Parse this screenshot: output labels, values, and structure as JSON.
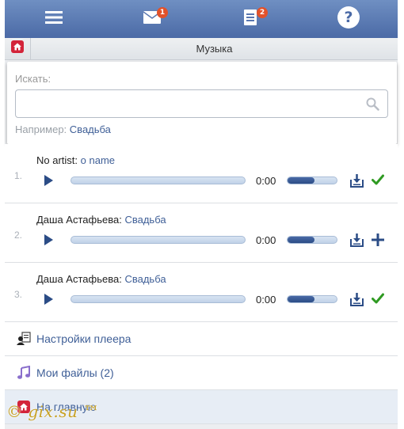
{
  "topbar": {
    "menu_icon": "hamburger-menu-icon",
    "messages_icon": "envelope-icon",
    "messages_badge": "1",
    "notifications_icon": "document-list-icon",
    "notifications_badge": "2",
    "help_icon": "help-question-icon"
  },
  "header": {
    "home_icon": "home-icon",
    "title": "Музыка"
  },
  "search": {
    "label": "Искать:",
    "value": "",
    "placeholder": "",
    "icon": "search-icon",
    "example_label": "Например:",
    "example_value": "Свадьба"
  },
  "tracks": [
    {
      "number": "1.",
      "artist": "No artist:",
      "song": "o name",
      "time": "0:00",
      "volume": 0.55,
      "action_icon": "check-icon"
    },
    {
      "number": "2.",
      "artist": "Даша Астафьева:",
      "song": "Свадьба",
      "time": "0:00",
      "volume": 0.55,
      "action_icon": "plus-icon"
    },
    {
      "number": "3.",
      "artist": "Даша Астафьева:",
      "song": "Свадьба",
      "time": "0:00",
      "volume": 0.55,
      "action_icon": "check-icon"
    }
  ],
  "menu": {
    "player_settings": "Настройки плеера",
    "my_files": "Мои файлы (2)",
    "home": "На главную"
  },
  "watermark": "© gix.su ™",
  "colors": {
    "bar": "#4b6aa6",
    "link": "#3f5f97",
    "badge": "#e2522a",
    "check": "#2f9a22",
    "watermark": "#c8a227"
  }
}
